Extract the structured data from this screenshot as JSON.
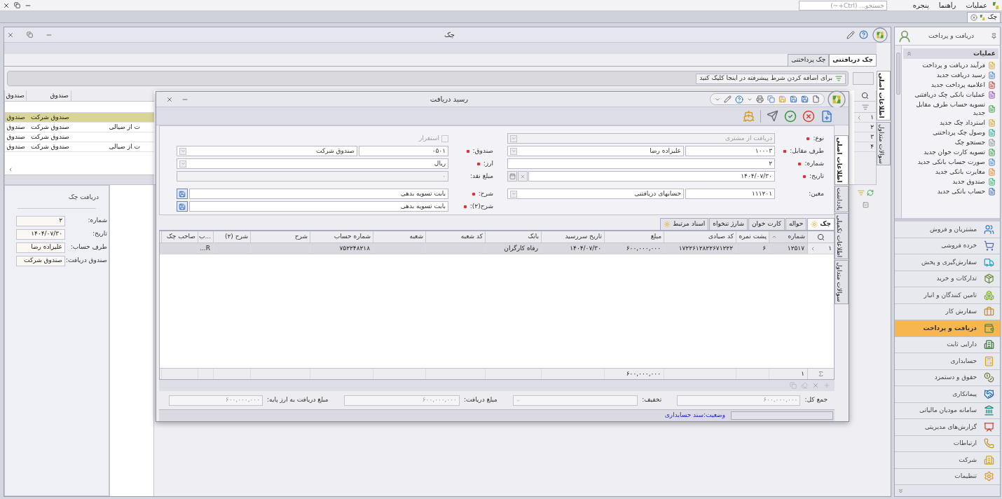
{
  "menu_bar": {
    "menus": [
      "عملیات",
      "راهنما",
      "پنجره"
    ],
    "search": {
      "placeholder": "جستجو... (Ctrl+~)"
    }
  },
  "document_tabs": [
    {
      "label": "چک",
      "selected": true
    }
  ],
  "main_window": {
    "title": "چک",
    "tabs": [
      {
        "label": "چک دریافتنی",
        "selected": true
      },
      {
        "label": "چک پرداختنی",
        "selected": false
      }
    ],
    "filter_hint": "برای اضافه کردن شرط پیشرفته در اینجا کلیک کنید",
    "grid": {
      "columns": [
        "صندوق",
        "صندوق"
      ],
      "rows": [
        {
          "number": "۱",
          "selected": true,
          "cells": [
            "صندوق شرکت",
            "صندوق"
          ]
        },
        {
          "number": "۲",
          "selected": false,
          "note": "ت از ضیالی",
          "cells": [
            "صندوق شرکت",
            "صندوق"
          ]
        },
        {
          "number": "۳",
          "selected": false,
          "cells": [
            "صندوق شرکت",
            "صندوق"
          ]
        },
        {
          "number": "۴",
          "selected": false,
          "note": "ت از ضیالی",
          "cells": [
            "صندوق شرکت",
            "صندوق"
          ]
        }
      ]
    },
    "detail": {
      "title": "دریافت چک",
      "fields": [
        {
          "label": "شماره:",
          "value": "۲"
        },
        {
          "label": "تاریخ:",
          "value": "۱۴۰۴/۰۷/۳۰"
        },
        {
          "label": "طرف حساب:",
          "value": "علیزاده رضا"
        },
        {
          "label": "صندوق دریافت:",
          "value": "صندوق شرکت"
        }
      ]
    },
    "side_tabs": [
      {
        "label": "اطلاعات اصلی",
        "selected": true
      },
      {
        "label": "سوالات متداول",
        "selected": false
      }
    ]
  },
  "dialog": {
    "title": "رسید دریافت",
    "form": {
      "right": [
        {
          "kind": "combo",
          "label": "نوع:",
          "required": true,
          "value": "دریافت از مشتری",
          "disabled": true
        },
        {
          "kind": "code_combo",
          "label": "طرف مقابل:",
          "required": true,
          "code": "۱۰۰۰۳",
          "value": "علیزاده رضا",
          "disabled": false
        },
        {
          "kind": "text",
          "label": "شماره:",
          "required": true,
          "value": "۲",
          "disabled": false
        },
        {
          "kind": "date",
          "label": "تاریخ:",
          "required": true,
          "value": "۱۴۰۴/۰۷/۳۰",
          "disabled": false
        },
        {
          "kind": "code_combo",
          "label": "معین:",
          "required": false,
          "code": "۱۱۱۲۰۱",
          "value": "حسابهای دریافتنی",
          "disabled": false
        }
      ],
      "left": [
        {
          "kind": "checkbox",
          "label": "استقرار",
          "checked": false,
          "disabled": true
        },
        {
          "kind": "code_combo",
          "label": "صندوق:",
          "required": true,
          "code": "۰۵۰۱",
          "value": "صندوق شرکت",
          "disabled": false
        },
        {
          "kind": "combo",
          "label": "ارز:",
          "required": true,
          "value": "ریال",
          "disabled": false
        },
        {
          "kind": "text",
          "label": "مبلغ نقد:",
          "required": false,
          "value": "۰",
          "disabled": true
        },
        {
          "kind": "memo",
          "label": "شرح:",
          "required": true,
          "value": "بابت تسویه بدهی",
          "disabled": false
        },
        {
          "kind": "memo",
          "label": "شرح(۲):",
          "required": true,
          "value": "بابت تسویه بدهی",
          "disabled": false
        }
      ]
    },
    "tabs": [
      {
        "label": "چک",
        "icon": true,
        "selected": true
      },
      {
        "label": "حواله",
        "icon": false,
        "selected": false
      },
      {
        "label": "کارت خوان",
        "icon": false,
        "selected": false
      },
      {
        "label": "شارژ تنخواه",
        "icon": false,
        "selected": false
      },
      {
        "label": "اسناد مرتبط",
        "icon": true,
        "selected": false
      }
    ],
    "grid": {
      "columns": [
        {
          "label": "شماره",
          "sorted": true
        },
        {
          "label": "پشت نمره",
          "sorted": false
        },
        {
          "label": "کد صیادی",
          "sorted": false
        },
        {
          "label": "مبلغ",
          "sorted": false
        },
        {
          "label": "تاریخ سررسید",
          "sorted": false
        },
        {
          "label": "بانک",
          "sorted": false
        },
        {
          "label": "کد شعبه",
          "sorted": false
        },
        {
          "label": "شعبه",
          "sorted": false
        },
        {
          "label": "شماره حساب",
          "sorted": false
        },
        {
          "label": "شرح",
          "sorted": false
        },
        {
          "label": "شرح (۲)",
          "sorted": false
        },
        {
          "label": "...ب",
          "sorted": false
        },
        {
          "label": "صاحب چک",
          "sorted": false
        }
      ],
      "rows": [
        {
          "number": "۱",
          "selected": true,
          "cells": [
            "۱۲۵۱۷",
            "۶",
            "۱۷۲۲۶۱۲۸۲۲۶۷۱۲۲۲",
            "۶۰۰,۰۰۰,۰۰۰",
            "۱۴۰۴/۰۷/۳۰",
            "رفاه کارگران",
            null,
            null,
            "۷۵۲۲۴۸۲۱۸",
            null,
            null,
            "R...",
            null
          ]
        }
      ],
      "summary": {
        "count": "۱",
        "amount": "۶۰۰,۰۰۰,۰۰۰"
      }
    },
    "totals": [
      {
        "kind": "text",
        "label": "جمع کل:",
        "value": "۶۰۰,۰۰۰,۰۰۰"
      },
      {
        "kind": "combo",
        "label": "تخفیف:"
      },
      {
        "kind": "text",
        "label": "مبلغ دریافت:",
        "value": "۶۰۰,۰۰۰,۰۰۰"
      },
      {
        "kind": "text",
        "label": "مبلغ دریافت به ارز پایه:",
        "value": "۶۰۰,۰۰۰,۰۰۰"
      }
    ],
    "status": "وضعیت:سند حسابداری",
    "side_tabs": [
      {
        "label": "اطلاعات اصلی",
        "selected": true
      },
      {
        "label": "یادداشت",
        "selected": false
      },
      {
        "label": "اطلاعات تکمیلی",
        "selected": false
      },
      {
        "label": "سوالات متداول",
        "selected": false
      }
    ]
  },
  "sidebar": {
    "title": "دریافت و پرداخت",
    "section": {
      "title": "عملیات",
      "expanded": true,
      "items": [
        "فرآیند دریافت و پرداخت",
        "رسید دریافت جدید",
        "اعلامیه پرداخت جدید",
        "عملیات بانکی چک دریافتنی",
        "تسویه حساب طرف مقابل جدید",
        "استرداد چک جدید",
        "وصول چک پرداختنی",
        "جستجو چک",
        "تسویه کارت خوان جدید",
        "صورت حساب بانکی جدید",
        "مغایرت بانکی جدید",
        "صندوق جدید",
        "حساب بانکی جدید"
      ]
    },
    "modules": [
      {
        "label": "مشتریان و فروش",
        "selected": false
      },
      {
        "label": "خرده فروشی",
        "selected": false
      },
      {
        "label": "سفارش‌گیری و پخش",
        "selected": false
      },
      {
        "label": "تدارکات و خرید",
        "selected": false
      },
      {
        "label": "تامین کنندگان و انبار",
        "selected": false
      },
      {
        "label": "سفارش کار",
        "selected": false
      },
      {
        "label": "دریافت و پرداخت",
        "selected": true
      },
      {
        "label": "دارایی ثابت",
        "selected": false
      },
      {
        "label": "حسابداری",
        "selected": false
      },
      {
        "label": "حقوق و دستمزد",
        "selected": false
      },
      {
        "label": "پیمانکاری",
        "selected": false
      },
      {
        "label": "سامانه مودیان مالیاتی",
        "selected": false
      },
      {
        "label": "گزارش‌های مدیریتی",
        "selected": false
      },
      {
        "label": "ارتباطات",
        "selected": false
      },
      {
        "label": "شرکت",
        "selected": false
      },
      {
        "label": "تنظیمات",
        "selected": false
      }
    ]
  }
}
